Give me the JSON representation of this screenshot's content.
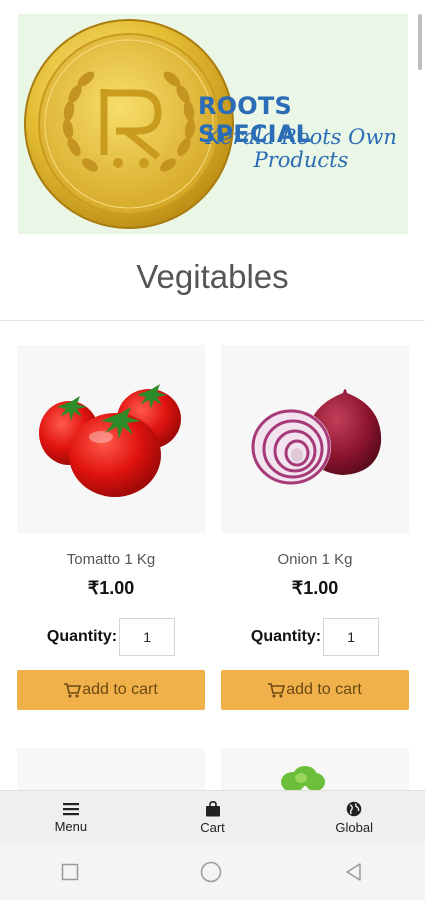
{
  "banner": {
    "title": "ROOTS SPECIAL",
    "subtitle": "Kerala Roots Own Products",
    "logo_letter": "R",
    "colors": {
      "background": "#eaf6e6",
      "text": "#2a6cb5",
      "coin": "#e8c23a"
    }
  },
  "section": {
    "title": "Vegitables"
  },
  "products": [
    {
      "name": "Tomatto 1 Kg",
      "price": "₹1.00",
      "quantity_label": "Quantity:",
      "quantity": "1",
      "button": "add to cart",
      "image_icon": "tomato-image"
    },
    {
      "name": "Onion 1 Kg",
      "price": "₹1.00",
      "quantity_label": "Quantity:",
      "quantity": "1",
      "button": "add to cart",
      "image_icon": "onion-image"
    }
  ],
  "bottom_nav": [
    {
      "label": "Menu",
      "icon": "menu-icon"
    },
    {
      "label": "Cart",
      "icon": "cart-icon"
    },
    {
      "label": "Global",
      "icon": "globe-icon"
    }
  ],
  "system_nav": [
    "recents-icon",
    "home-icon",
    "back-icon"
  ],
  "colors": {
    "accent": "#f0b04a"
  }
}
